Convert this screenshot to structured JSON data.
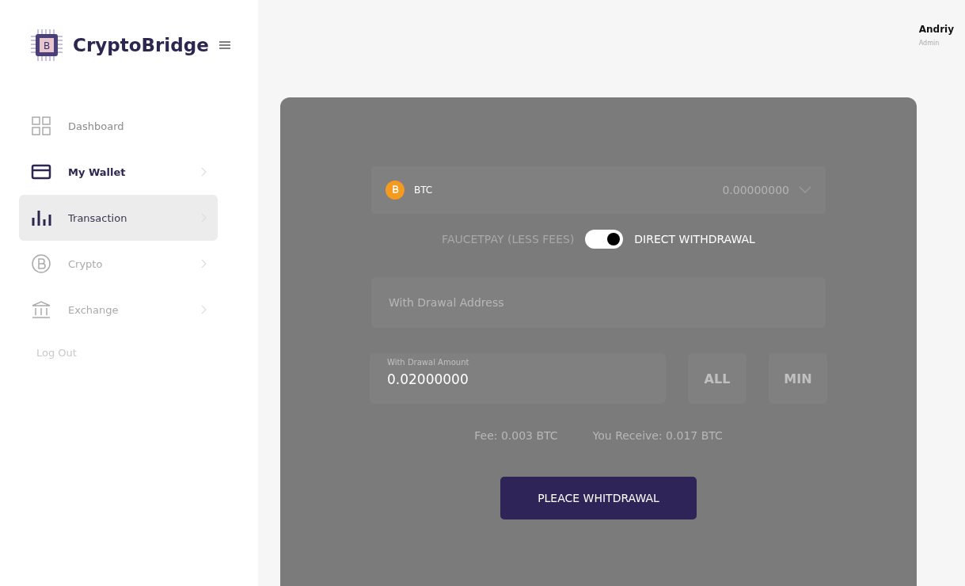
{
  "brand": {
    "name": "CryptoBridge",
    "logo_letter": "B"
  },
  "sidebar": {
    "items": [
      {
        "kind": "grid",
        "label": "Dashboard",
        "selected": false,
        "emphasized": false,
        "chevron": false
      },
      {
        "kind": "card",
        "label": "My Wallet",
        "selected": false,
        "emphasized": true,
        "chevron": true
      },
      {
        "kind": "bars",
        "label": "Transaction",
        "selected": true,
        "emphasized": false,
        "chevron": true
      },
      {
        "kind": "coin",
        "label": "Crypto",
        "selected": false,
        "emphasized": false,
        "chevron": true
      },
      {
        "kind": "bank",
        "label": "Exchange",
        "selected": false,
        "emphasized": false,
        "chevron": true
      }
    ],
    "logout": "Log Out"
  },
  "user": {
    "name": "Andriy",
    "role": "Admin"
  },
  "withdraw": {
    "currency": {
      "symbol": "BTC",
      "balance": "0.00000000"
    },
    "toggle": {
      "left_label": "FAUCETPAY (LESS FEES)",
      "right_label": "DIRECT WITHDRAWAL",
      "on": true
    },
    "address": {
      "placeholder": "With Drawal Address"
    },
    "amount": {
      "label": "With Drawal Amount",
      "value": "0.02000000"
    },
    "buttons": [
      "ALL",
      "MIN"
    ],
    "fee": "Fee: 0.003 BTC",
    "receive": "You Receive: 0.017 BTC",
    "submit": "PLEACE WHITDRAWAL"
  }
}
